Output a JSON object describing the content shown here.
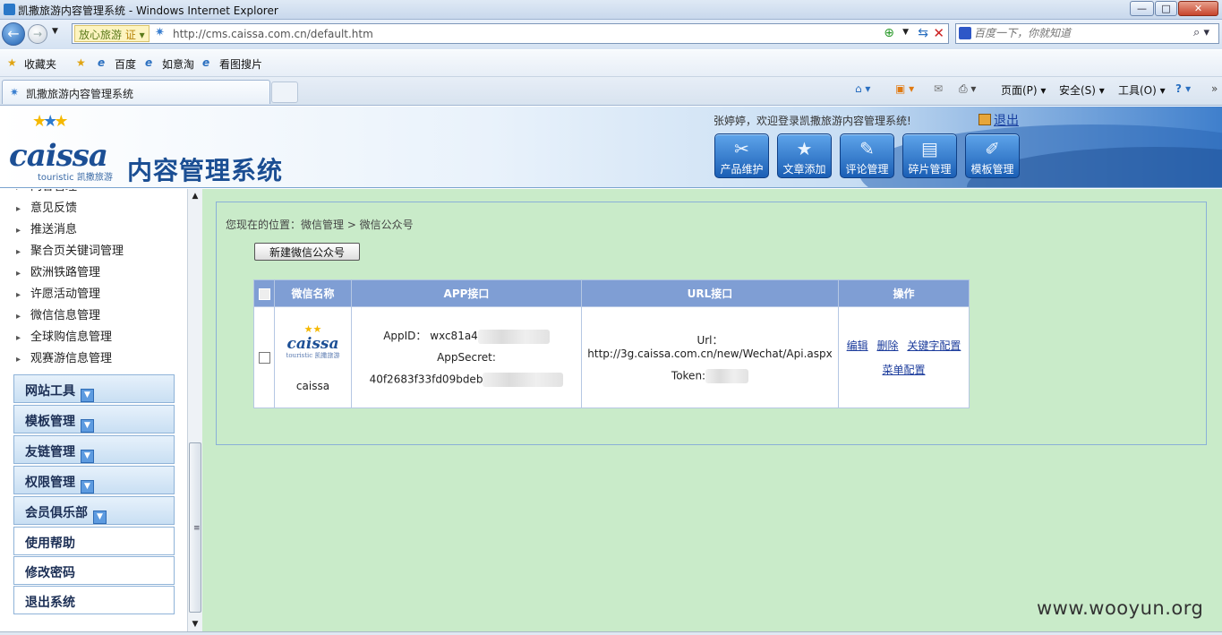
{
  "window": {
    "title": "凯撒旅游内容管理系统 - Windows Internet Explorer",
    "min": "—",
    "max": "□",
    "close": "✕"
  },
  "nav": {
    "badge": "放心旅游",
    "badge_icon": "证",
    "url": "http://cms.caissa.com.cn/default.htm",
    "search_placeholder": "百度一下，你就知道"
  },
  "favorites": {
    "label": "收藏夹",
    "items": [
      "百度",
      "如意淘",
      "看图搜片"
    ]
  },
  "tab": {
    "title": "凯撒旅游内容管理系统"
  },
  "commands": {
    "page": "页面(P)",
    "safety": "安全(S)",
    "tools": "工具(O)",
    "help": "?"
  },
  "header": {
    "logo": "caissa",
    "logo_sub": "touristic 凯撒旅游",
    "system_title": "内容管理系统",
    "welcome": "张婷婷，欢迎登录凯撒旅游内容管理系统!",
    "logout": "退出",
    "modules": [
      {
        "label": "产品维护",
        "icon": "tools-icon"
      },
      {
        "label": "文章添加",
        "icon": "star-add-icon"
      },
      {
        "label": "评论管理",
        "icon": "comment-icon"
      },
      {
        "label": "碎片管理",
        "icon": "fragment-icon"
      },
      {
        "label": "模板管理",
        "icon": "template-icon"
      }
    ]
  },
  "sidebar": {
    "subitems": [
      "问答管理",
      "意见反馈",
      "推送消息",
      "聚合页关键词管理",
      "欧洲铁路管理",
      "许愿活动管理",
      "微信信息管理",
      "全球购信息管理",
      "观赛游信息管理"
    ],
    "menus": [
      "网站工具",
      "模板管理",
      "友链管理",
      "权限管理",
      "会员俱乐部"
    ],
    "plain": [
      "使用帮助",
      "修改密码",
      "退出系统"
    ]
  },
  "main": {
    "breadcrumb": "您现在的位置：微信管理 > 微信公众号",
    "new_button": "新建微信公众号",
    "columns": [
      "微信名称",
      "APP接口",
      "URL接口",
      "操作"
    ],
    "rows": [
      {
        "name": "caissa",
        "appid_label": "AppID：",
        "appid": "wxc81a4",
        "secret_label": "AppSecret:",
        "secret": "40f2683f33fd09bdeb",
        "url_label": "Url：",
        "url": "http://3g.caissa.com.cn/new/Wechat/Api.aspx",
        "token_label": "Token:",
        "ops": [
          "编辑",
          "删除",
          "关键字配置",
          "菜单配置"
        ]
      }
    ]
  },
  "watermark": "www.wooyun.org"
}
